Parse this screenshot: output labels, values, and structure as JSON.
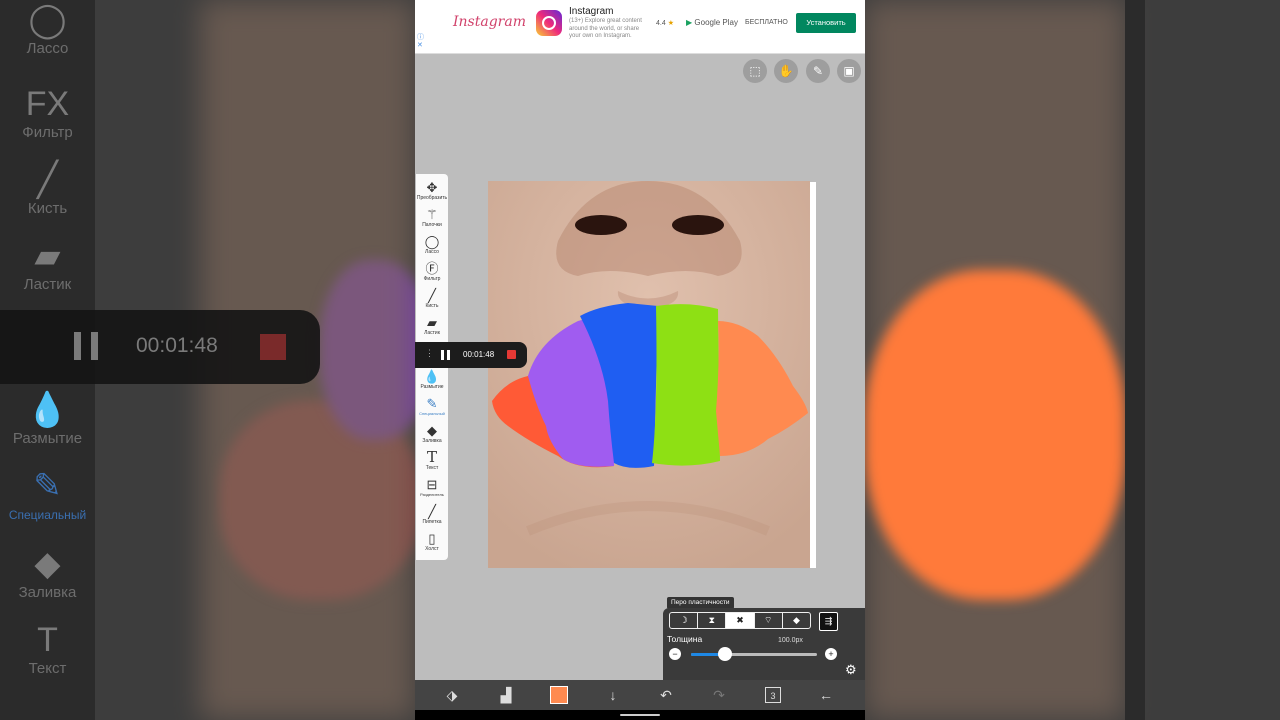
{
  "background": {
    "toolbar_items": [
      {
        "label": "Лассо",
        "icon": "lasso-icon",
        "glyph": "◯"
      },
      {
        "label": "Фильтр",
        "icon": "fx-icon",
        "glyph": "FX"
      },
      {
        "label": "Кисть",
        "icon": "brush-icon",
        "glyph": "╱"
      },
      {
        "label": "Ластик",
        "icon": "eraser-icon",
        "glyph": "▰"
      },
      {
        "label": "Размытие",
        "icon": "blur-drop-icon",
        "glyph": "💧"
      },
      {
        "label": "Специальный",
        "icon": "special-pen-icon",
        "glyph": "✎"
      },
      {
        "label": "Заливка",
        "icon": "fill-bucket-icon",
        "glyph": "◆"
      },
      {
        "label": "Текст",
        "icon": "text-icon",
        "glyph": "T"
      }
    ],
    "recording_time": "00:01:48"
  },
  "ad": {
    "logo_text": "Instagram",
    "app_title": "Instagram",
    "description": "(13+) Explore great content around the world, or share your own on Instagram.",
    "rating": "4.4",
    "store": "Google Play",
    "price": "БЕСПЛАТНО",
    "install_label": "Установить"
  },
  "toolbar": {
    "items": [
      {
        "label": "Преобразить",
        "glyph": "✥",
        "icon": "move-icon"
      },
      {
        "label": "Палочки",
        "glyph": "⚚",
        "icon": "magic-wand-icon"
      },
      {
        "label": "Лассо",
        "glyph": "◯",
        "icon": "lasso-icon"
      },
      {
        "label": "Фильтр",
        "glyph": "Ⓕ",
        "icon": "fx-icon"
      },
      {
        "label": "Кисть",
        "glyph": "╱",
        "icon": "brush-icon"
      },
      {
        "label": "Ластик",
        "glyph": "▰",
        "icon": "eraser-icon"
      },
      {
        "label": "",
        "glyph": "●",
        "icon": "smudge-icon"
      },
      {
        "label": "Размытие",
        "glyph": "💧",
        "icon": "blur-drop-icon"
      },
      {
        "label": "Специальный",
        "glyph": "✎",
        "icon": "special-pen-icon"
      },
      {
        "label": "Заливка",
        "glyph": "◆",
        "icon": "fill-bucket-icon"
      },
      {
        "label": "Текст",
        "glyph": "T",
        "icon": "text-icon"
      },
      {
        "label": "Разделитель",
        "glyph": "⊟",
        "icon": "frame-divider-icon"
      },
      {
        "label": "Пипетка",
        "glyph": "╱",
        "icon": "eyedropper-icon"
      },
      {
        "label": "Холст",
        "glyph": "▯",
        "icon": "canvas-icon"
      }
    ]
  },
  "recorder": {
    "time": "00:01:48"
  },
  "pen_panel": {
    "title": "Перо пластичности",
    "modes": [
      {
        "glyph": "☽",
        "icon": "stroke-fade-icon"
      },
      {
        "glyph": "⧗",
        "icon": "stroke-taper-icon"
      },
      {
        "glyph": "✖",
        "icon": "stroke-both-icon"
      },
      {
        "glyph": "⌔",
        "icon": "stroke-pressure-icon"
      },
      {
        "glyph": "◆",
        "icon": "stroke-eraser-icon"
      }
    ],
    "selected_mode": 2,
    "thickness_label": "Толщина",
    "thickness_value": "100.0px",
    "slider_fraction": 0.27
  },
  "colors": {
    "current_color": "#ff8a50",
    "stripes": [
      "#ff5a36",
      "#a05cf0",
      "#1f5ef2",
      "#8ee014",
      "#ff8a50"
    ]
  },
  "bottom_bar": {
    "layer_count": "3"
  }
}
